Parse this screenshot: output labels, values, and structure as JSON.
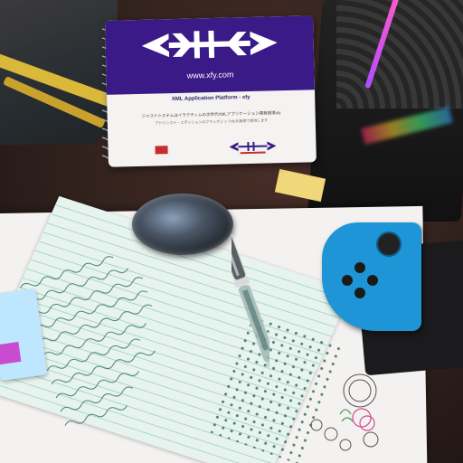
{
  "notebook": {
    "url": "www.xfy.com",
    "platform": "XML Application Platform - xfy",
    "japanese_line1": "ジャストシステムはイラクティムの次世代XMLアプリケーション開発環境xfy",
    "japanese_line2": "アドバンスド・エディションのフラッグシップxfyを無償で提供します",
    "brand_color": "#3a1a86"
  },
  "colors": {
    "joycon": "#1e95d6",
    "notecard": "#e7f3ee",
    "ruled_lines": "#a9d9c4"
  }
}
